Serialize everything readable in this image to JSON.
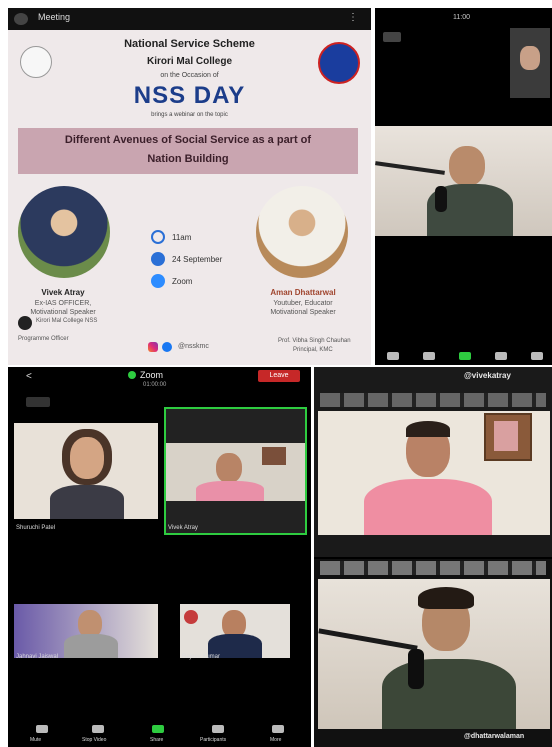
{
  "poster": {
    "app_bar_title": "Meeting",
    "org": "National Service Scheme",
    "college": "Kirori Mal College",
    "occasion": "on the Occasion of",
    "event": "NSS DAY",
    "tagline": "brings a webinar on the topic",
    "topic_line1": "Different Avenues of Social Service as a part of",
    "topic_line2": "Nation Building",
    "time": "11am",
    "date": "24 September",
    "platform": "Zoom",
    "speaker_left_name": "Vivek Atray",
    "speaker_left_role1": "Ex-IAS OFFICER,",
    "speaker_left_role2": "Motivational Speaker",
    "speaker_right_name": "Aman Dhattarwal",
    "speaker_right_role1": "Youtuber, Educator",
    "speaker_right_role2": "Motivational Speaker",
    "footer_left1": "Kirori Mal College NSS",
    "footer_left2": "Programme Officer",
    "social_handle": "@nsskmc",
    "footer_right1": "Prof. Vibha Singh Chauhan",
    "footer_right2": "Principal, KMC"
  },
  "top_right": {
    "time": "11:00"
  },
  "zoom_gallery": {
    "back": "<",
    "app_name": "Zoom",
    "timer": "01:00:00",
    "leave": "Leave",
    "tiles": [
      {
        "label": "Shuruchi Patel"
      },
      {
        "label": "Vivek Atray"
      },
      {
        "label": "Jahnavi Jaiswal"
      },
      {
        "label": "Rajeev Kumar"
      }
    ],
    "toolbar": [
      "Mute",
      "Stop Video",
      "Share",
      "Participants",
      "More"
    ]
  },
  "speaker_view_top": {
    "handle": "@vivekatray"
  },
  "speaker_view_bottom": {
    "handle": "@dhattarwalaman"
  },
  "colors": {
    "accent_green": "#2ecc40",
    "leave_red": "#c62828",
    "band": "#c9a5b0"
  }
}
